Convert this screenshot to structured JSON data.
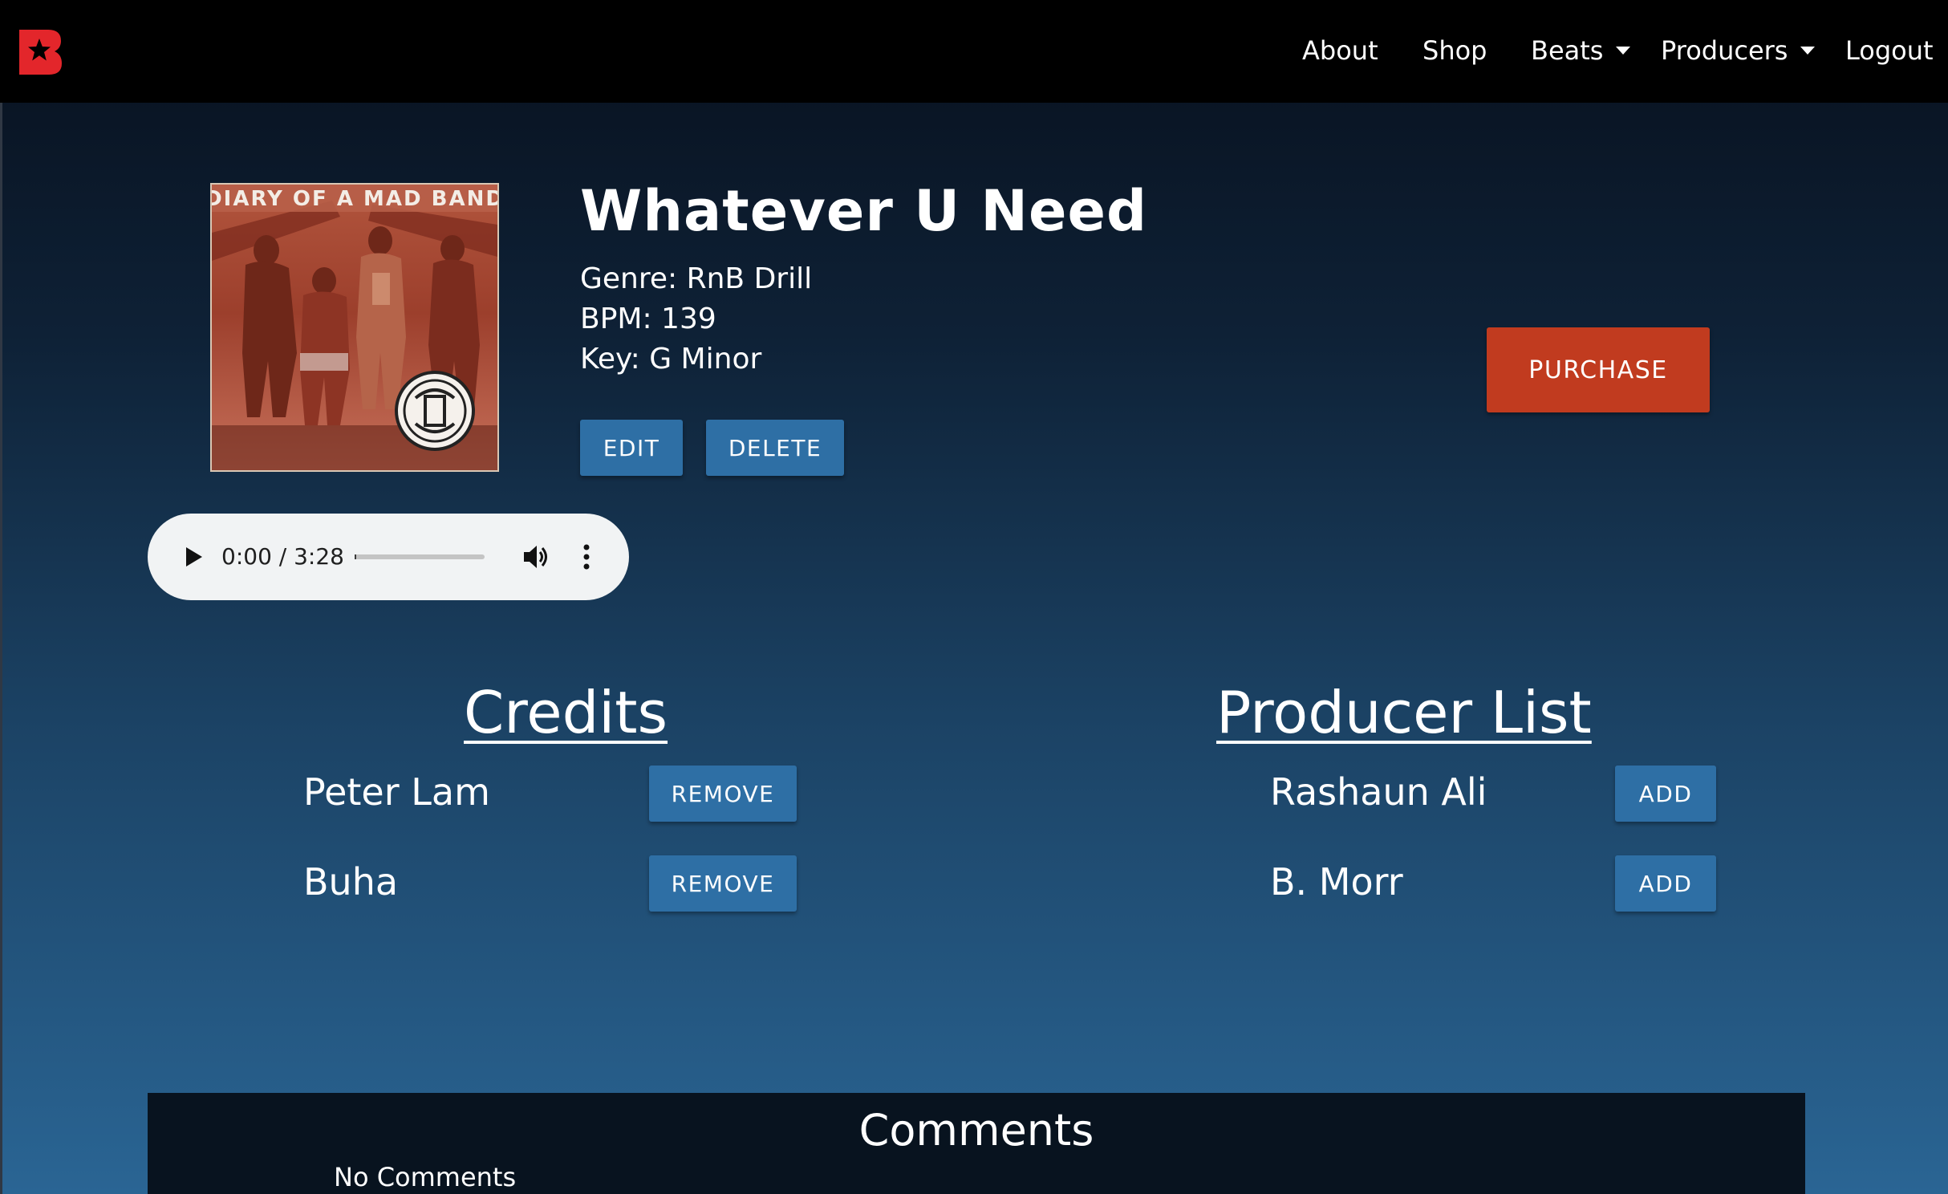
{
  "nav": {
    "logo_letter": "B",
    "links": {
      "about": "About",
      "shop": "Shop",
      "beats": "Beats",
      "producers": "Producers",
      "logout": "Logout"
    }
  },
  "album": {
    "caption": "DIARY OF A MAD BAND"
  },
  "beat": {
    "title": "Whatever U Need",
    "genre": "Genre: RnB Drill",
    "bpm": "BPM: 139",
    "key": "Key: G Minor"
  },
  "actions": {
    "edit_label": "EDIT",
    "delete_label": "DELETE",
    "purchase_label": "PURCHASE"
  },
  "player": {
    "time": "0:00 / 3:28",
    "progress_fraction": 0.0
  },
  "credits": {
    "heading": "Credits",
    "items": [
      {
        "name": "Peter Lam",
        "action": "REMOVE"
      },
      {
        "name": "Buha",
        "action": "REMOVE"
      }
    ]
  },
  "producer_list": {
    "heading": "Producer List",
    "items": [
      {
        "name": "Rashaun Ali",
        "action": "ADD"
      },
      {
        "name": "B. Morr",
        "action": "ADD"
      }
    ]
  },
  "comments": {
    "heading": "Comments",
    "empty_text": "No Comments"
  },
  "colors": {
    "nav_background": "#000000",
    "logo_red": "#e3262b",
    "button_blue": "#2e6fa5",
    "button_red": "#c13b1f",
    "player_background": "#f1f3f4",
    "comments_background": "#08131f"
  }
}
